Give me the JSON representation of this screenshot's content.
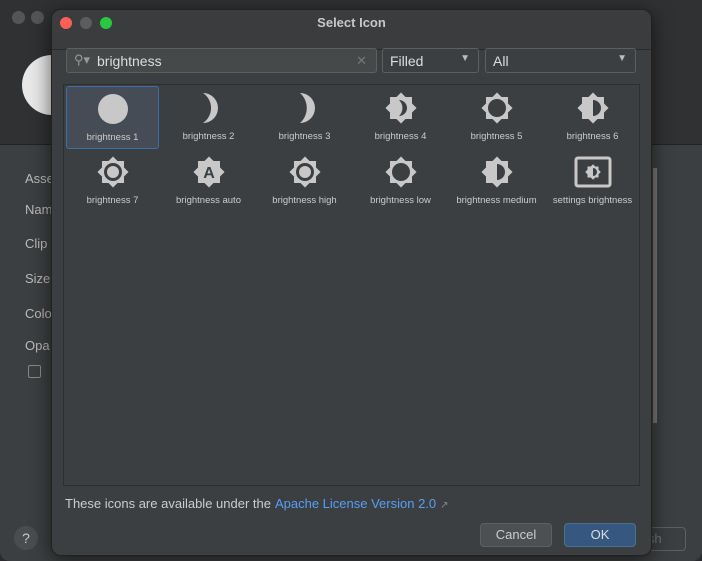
{
  "background": {
    "labels": [
      "Asse",
      "Nam",
      "Clip",
      "Size",
      "Colo",
      "Opa"
    ],
    "help_label": "?",
    "finish_label": "ish"
  },
  "dialog": {
    "title": "Select Icon",
    "search": {
      "value": "brightness"
    },
    "style_dropdown": {
      "value": "Filled"
    },
    "category_dropdown": {
      "value": "All"
    },
    "icons": [
      {
        "label": "brightness 1",
        "icon": "circle",
        "selected": true
      },
      {
        "label": "brightness 2",
        "icon": "moon-thick"
      },
      {
        "label": "brightness 3",
        "icon": "moon-thin"
      },
      {
        "label": "brightness 4",
        "icon": "sun-moon"
      },
      {
        "label": "brightness 5",
        "icon": "sun-ring"
      },
      {
        "label": "brightness 6",
        "icon": "sun-half"
      },
      {
        "label": "brightness 7",
        "icon": "sun-dot"
      },
      {
        "label": "brightness auto",
        "icon": "sun-a"
      },
      {
        "label": "brightness high",
        "icon": "sun-dot"
      },
      {
        "label": "brightness low",
        "icon": "sun-ring"
      },
      {
        "label": "brightness medium",
        "icon": "sun-half"
      },
      {
        "label": "settings brightness",
        "icon": "screen-sun"
      }
    ],
    "footer": {
      "text": "These icons are available under the",
      "link": "Apache License Version 2.0"
    },
    "cancel_label": "Cancel",
    "ok_label": "OK",
    "colors": {
      "accent": "#365880",
      "link": "#589df6",
      "selection": "#3d6ea5",
      "icon": "#c8c8c8"
    }
  }
}
